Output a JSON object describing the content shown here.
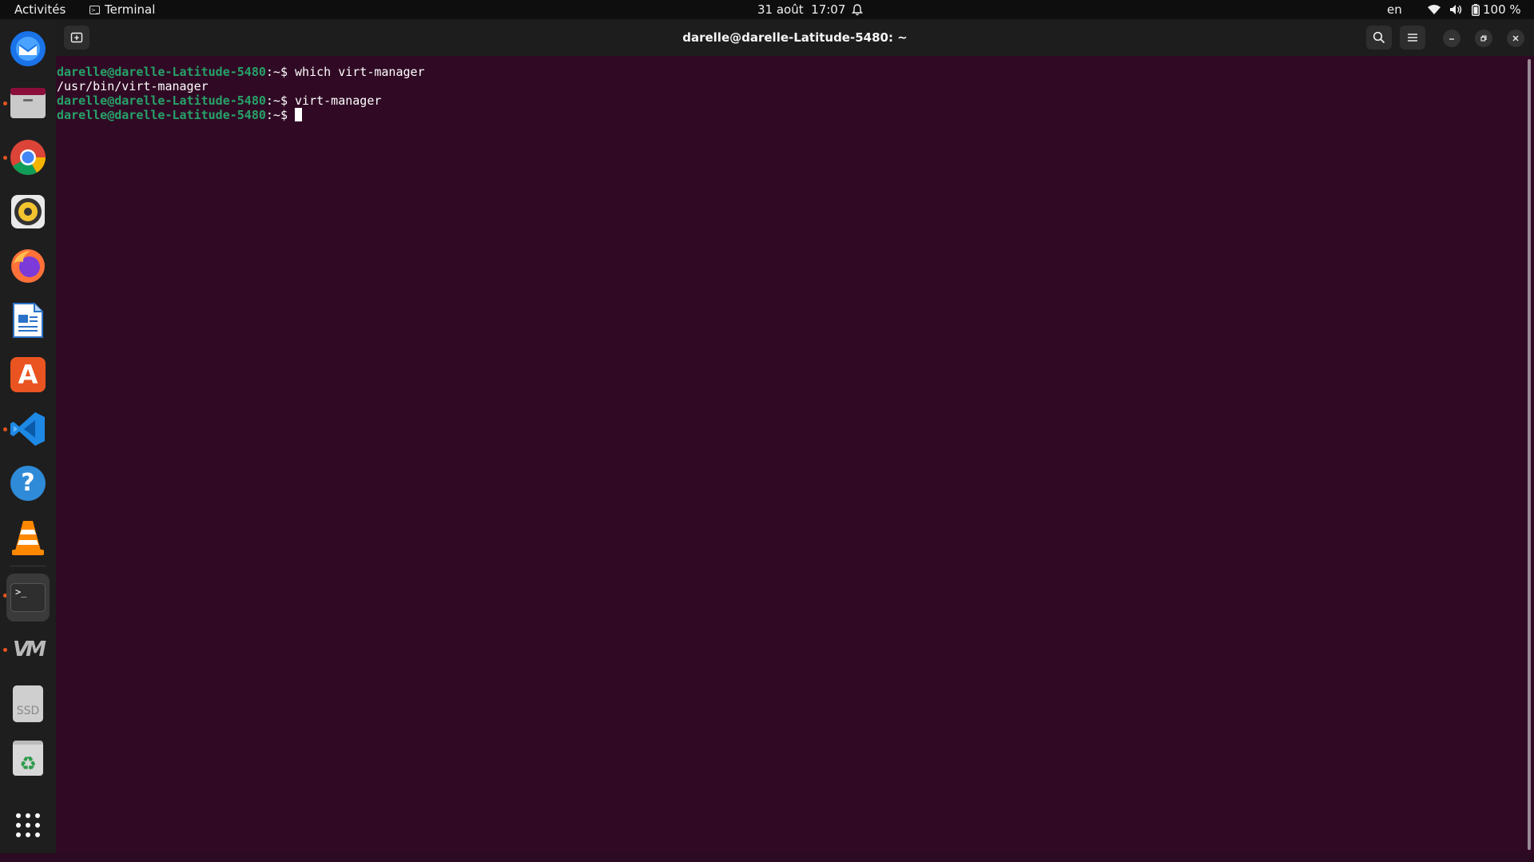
{
  "topbar": {
    "activities": "Activités",
    "app_name": "Terminal",
    "datetime": "31 août  17:07",
    "language": "en",
    "battery": "100 %"
  },
  "dock": {
    "items": [
      {
        "name": "thunderbird-icon"
      },
      {
        "name": "files-icon"
      },
      {
        "name": "chrome-icon"
      },
      {
        "name": "rhythmbox-icon"
      },
      {
        "name": "firefox-icon"
      },
      {
        "name": "libreoffice-writer-icon"
      },
      {
        "name": "app-center-icon",
        "glyph": "A"
      },
      {
        "name": "vscode-icon"
      },
      {
        "name": "help-icon",
        "glyph": "?"
      },
      {
        "name": "vlc-icon"
      },
      {
        "name": "terminal-icon",
        "glyph": ">_"
      },
      {
        "name": "virt-manager-icon",
        "glyph": "VM"
      },
      {
        "name": "ssd-drive-icon",
        "glyph": "SSD"
      },
      {
        "name": "trash-icon",
        "glyph": "♻"
      },
      {
        "name": "show-apps-icon"
      }
    ]
  },
  "window": {
    "title": "darelle@darelle-Latitude-5480: ~"
  },
  "terminal": {
    "lines": [
      {
        "prompt": "darelle@darelle-Latitude-5480",
        "sep": ":~$ ",
        "cmd": "which virt-manager"
      },
      {
        "output": "/usr/bin/virt-manager"
      },
      {
        "prompt": "darelle@darelle-Latitude-5480",
        "sep": ":~$ ",
        "cmd": "virt-manager"
      },
      {
        "prompt": "darelle@darelle-Latitude-5480",
        "sep": ":~$ ",
        "cmd": ""
      }
    ]
  },
  "colors": {
    "terminal_bg": "#300a24",
    "prompt_green": "#26a269",
    "accent_orange": "#e95420"
  }
}
